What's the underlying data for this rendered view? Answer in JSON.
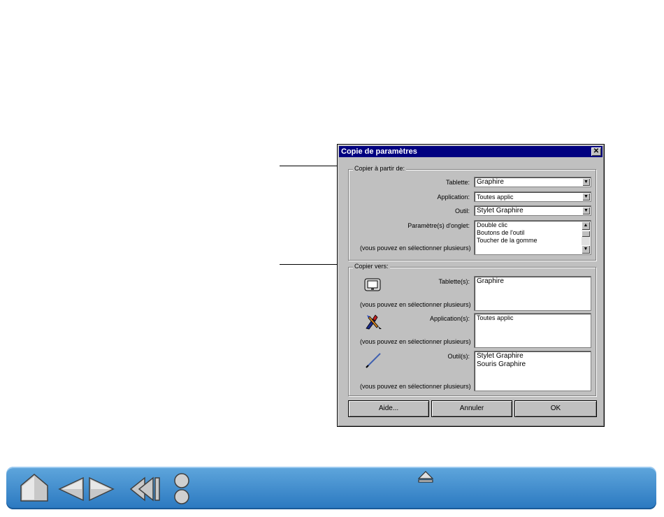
{
  "dialog": {
    "title": "Copie de paramètres",
    "copy_from": {
      "legend": "Copier à partir de:",
      "tablet_label": "Tablette:",
      "tablet_value": "Graphire",
      "application_label": "Application:",
      "application_value": "Toutes applic",
      "tool_label": "Outil:",
      "tool_value": "Stylet Graphire",
      "tab_settings_label": "Paramètre(s) d'onglet:",
      "tab_settings_items": [
        "Double clic",
        "Boutons de l'outil",
        "Toucher de la gomme"
      ],
      "multi_note": "(vous pouvez en sélectionner plusieurs)"
    },
    "copy_to": {
      "legend": "Copier vers:",
      "tablets_label": "Tablette(s):",
      "tablets_items": [
        "Graphire"
      ],
      "applications_label": "Application(s):",
      "applications_items": [
        "Toutes applic"
      ],
      "tools_label": "Outil(s):",
      "tools_items": [
        "Stylet Graphire",
        "Souris Graphire"
      ],
      "multi_note": "(vous pouvez en sélectionner plusieurs)"
    },
    "buttons": {
      "help": "Aide...",
      "cancel": "Annuler",
      "ok": "OK"
    }
  },
  "navbar": {
    "icons": [
      "home-icon",
      "previous-page-icon",
      "next-page-icon",
      "back-icon",
      "contents-index-icon",
      "eject-icon"
    ]
  }
}
